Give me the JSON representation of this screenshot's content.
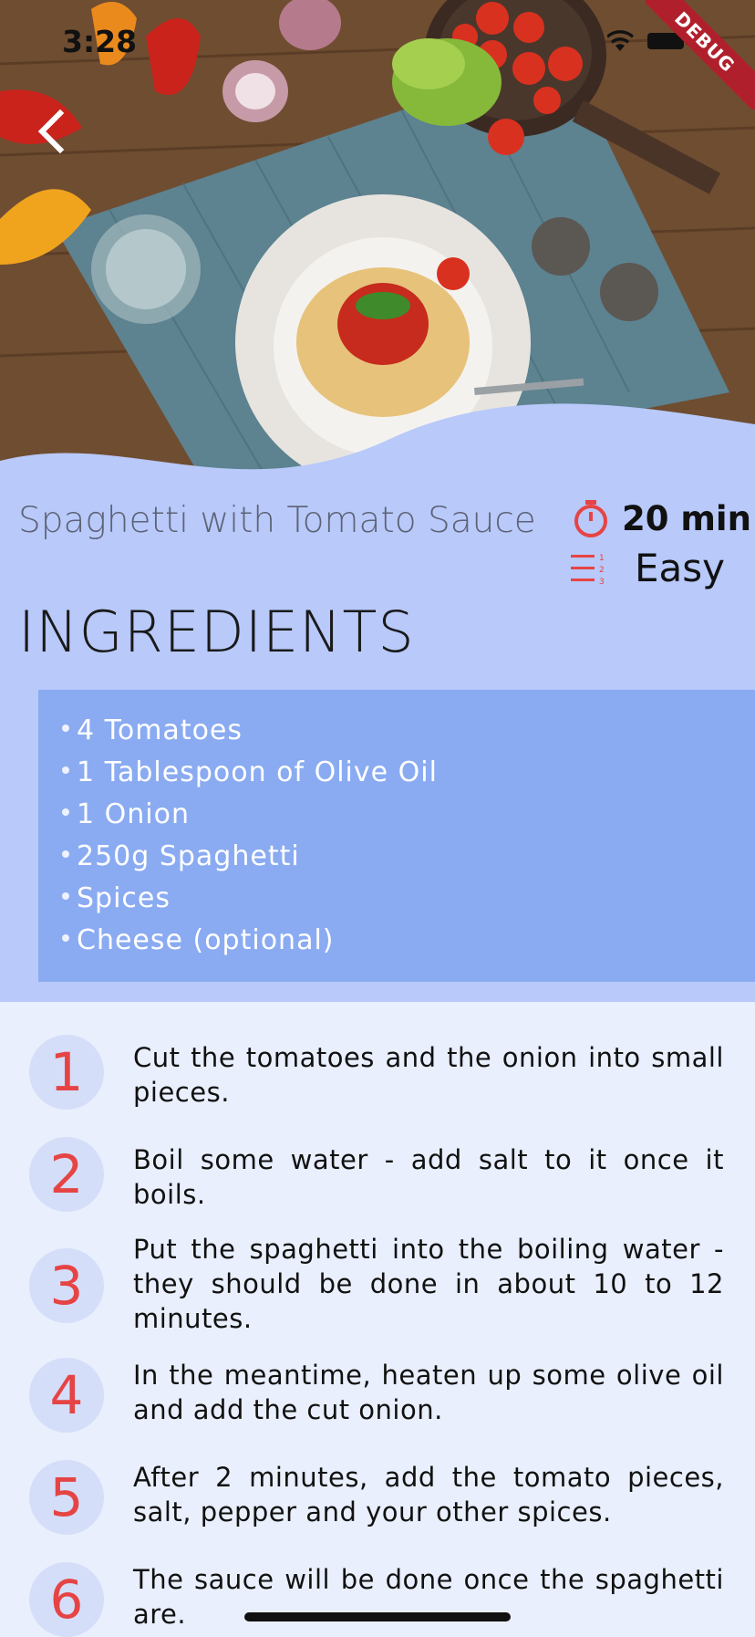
{
  "status_bar": {
    "time": "3:28"
  },
  "debug_banner": {
    "label": "DEBUG"
  },
  "recipe": {
    "title": "Spaghetti with Tomato Sauce",
    "time": "20 min",
    "difficulty": "Easy",
    "ingredients_heading": "INGREDIENTS",
    "ingredients": [
      "4 Tomatoes",
      "1 Tablespoon of Olive Oil",
      "1 Onion",
      "250g Spaghetti",
      "Spices",
      "Cheese (optional)"
    ],
    "steps": [
      {
        "num": "1",
        "text": "Cut the tomatoes and the onion into small pieces."
      },
      {
        "num": "2",
        "text": "Boil some water - add salt to it once it boils."
      },
      {
        "num": "3",
        "text": "Put the spaghetti into the boiling water - they should be done in about 10 to 12 minutes."
      },
      {
        "num": "4",
        "text": "In the meantime, heaten up some olive oil and add the cut onion."
      },
      {
        "num": "5",
        "text": "After 2 minutes, add the tomato pieces, salt, pepper and your other spices."
      },
      {
        "num": "6",
        "text": "The sauce will be done once the spaghetti are."
      }
    ]
  },
  "colors": {
    "accent_red": "#e64444",
    "info_bg": "#b8c9fa",
    "ingredients_bg": "#8aabf1",
    "steps_bg": "#e9effc",
    "step_circle": "#d4def9"
  }
}
